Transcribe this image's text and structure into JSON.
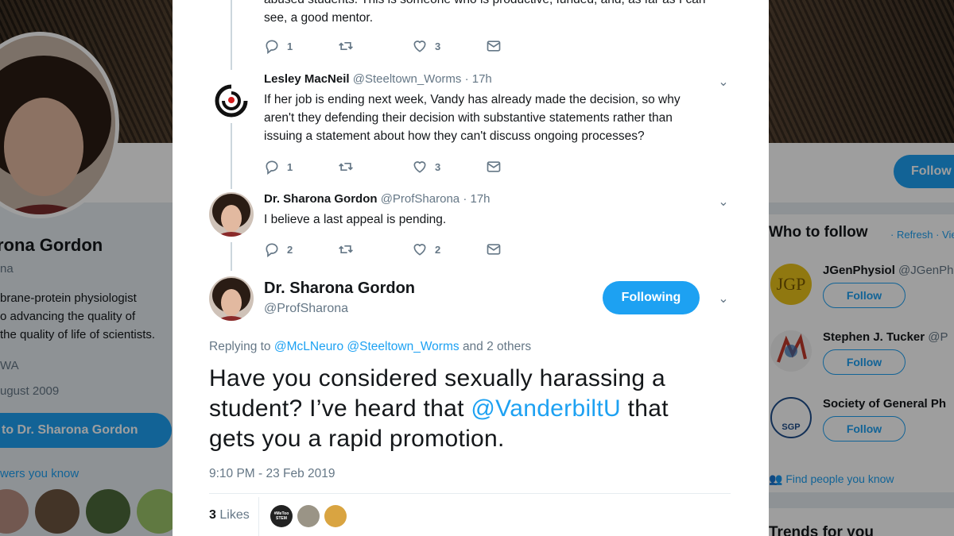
{
  "background_profile": {
    "name": "rona Gordon",
    "handle": "na",
    "bio": [
      "brane-protein physiologist",
      "o advancing the quality of",
      "the quality of life of scientists."
    ],
    "location": "WA",
    "joined": "ugust 2009",
    "tweet_to_label": "to Dr. Sharona Gordon",
    "followers_you_know": "wers you know",
    "follow_button": "Follow"
  },
  "who_to_follow": {
    "title": "Who to follow",
    "refresh": "Refresh",
    "view_all": "View",
    "items": [
      {
        "name": "JGenPhysiol",
        "handle": "@JGenPh",
        "follow": "Follow"
      },
      {
        "name": "Stephen J. Tucker",
        "handle": "@P",
        "follow": "Follow"
      },
      {
        "name": "Society of General Ph",
        "handle": "",
        "follow": "Follow"
      }
    ],
    "find_people": "Find people you know",
    "avatar_labels": {
      "jgp": "JGP",
      "sgp": "SGP"
    }
  },
  "trends": {
    "title": "Trends for you"
  },
  "thread": {
    "top_text_line1": "abused students. This is someone who is productive, funded, and, as far as I can",
    "top_text_line2": "see, a good mentor.",
    "top_actions": {
      "reply": "1",
      "retweet": "",
      "like": "3"
    },
    "replies": [
      {
        "name": "Lesley MacNeil",
        "handle": "@Steeltown_Worms",
        "time": "· 17h",
        "text": "If her job is ending next week, Vandy has already made the decision, so why aren't they defending their decision with substantive statements rather than issuing a statement about how they can't discuss ongoing processes?",
        "reply_count": "1",
        "like_count": "3"
      },
      {
        "name": "Dr. Sharona Gordon",
        "handle": "@ProfSharona",
        "time": "· 17h",
        "text": "I believe a last appeal is pending.",
        "reply_count": "2",
        "like_count": "2"
      }
    ]
  },
  "main_tweet": {
    "name": "Dr. Sharona Gordon",
    "handle": "@ProfSharona",
    "following_label": "Following",
    "replying_prefix": "Replying to",
    "replying_handles": [
      "@McLNeuro",
      "@Steeltown_Worms"
    ],
    "replying_suffix": "and 2 others",
    "text_before": "Have you considered sexually harassing a student? I’ve heard that ",
    "mention": "@VanderbiltU",
    "text_after": " that gets you a rapid promotion.",
    "timestamp": "9:10 PM - 23 Feb 2019",
    "likes_count": "3",
    "likes_label": "Likes",
    "liker_badge": "#MeToo STEM"
  },
  "colors": {
    "accent": "#1da1f2",
    "muted": "#657786",
    "text": "#14171a"
  }
}
